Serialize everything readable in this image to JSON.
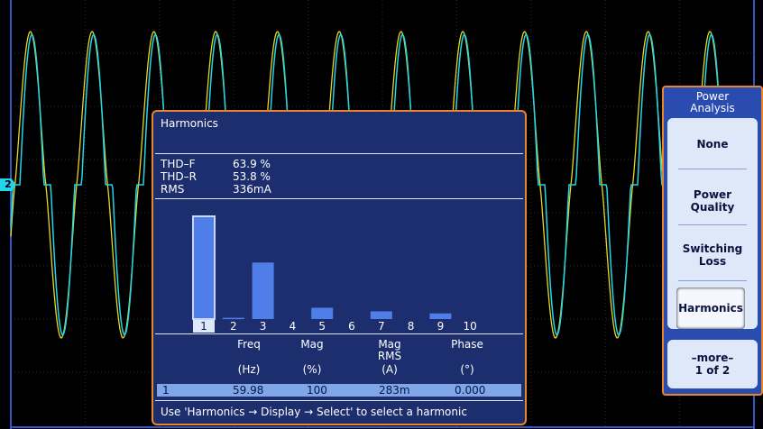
{
  "channel_marker": "2",
  "harmonics": {
    "title": "Harmonics",
    "stats": [
      {
        "label": "THD–F",
        "value": "63.9 %"
      },
      {
        "label": "THD–R",
        "value": "53.8 %"
      },
      {
        "label": "RMS",
        "value": "336mA"
      }
    ],
    "columns": [
      {
        "name": "Freq",
        "unit": "(Hz)"
      },
      {
        "name": "Mag",
        "unit": "(%)"
      },
      {
        "name": "Mag\nRMS",
        "unit": "(A)"
      },
      {
        "name": "Phase",
        "unit": "(°)"
      }
    ],
    "selected_row": {
      "index": "1",
      "freq": "59.98",
      "mag": "100",
      "mag_rms": "283m",
      "phase": "0.000"
    },
    "hint": "Use 'Harmonics → Display → Select' to select a harmonic"
  },
  "chart_data": {
    "type": "bar",
    "categories": [
      "1",
      "2",
      "3",
      "4",
      "5",
      "6",
      "7",
      "8",
      "9",
      "10"
    ],
    "values": [
      100,
      1.2,
      55,
      0,
      11,
      0,
      7.5,
      0,
      5.5,
      0
    ],
    "selected": "1",
    "ylim": [
      0,
      100
    ]
  },
  "menu": {
    "title": "Power Analysis",
    "items": [
      "None",
      "Power Quality",
      "Switching Loss",
      "Harmonics"
    ],
    "selected": "Harmonics",
    "more_label": "–more–",
    "more_page": "1 of 2"
  },
  "colors": {
    "ch1": "#e8d820",
    "ch2": "#22d6e8",
    "panel": "#1c2e6e",
    "bar": "#4f7ee8",
    "border": "#e8862a"
  }
}
